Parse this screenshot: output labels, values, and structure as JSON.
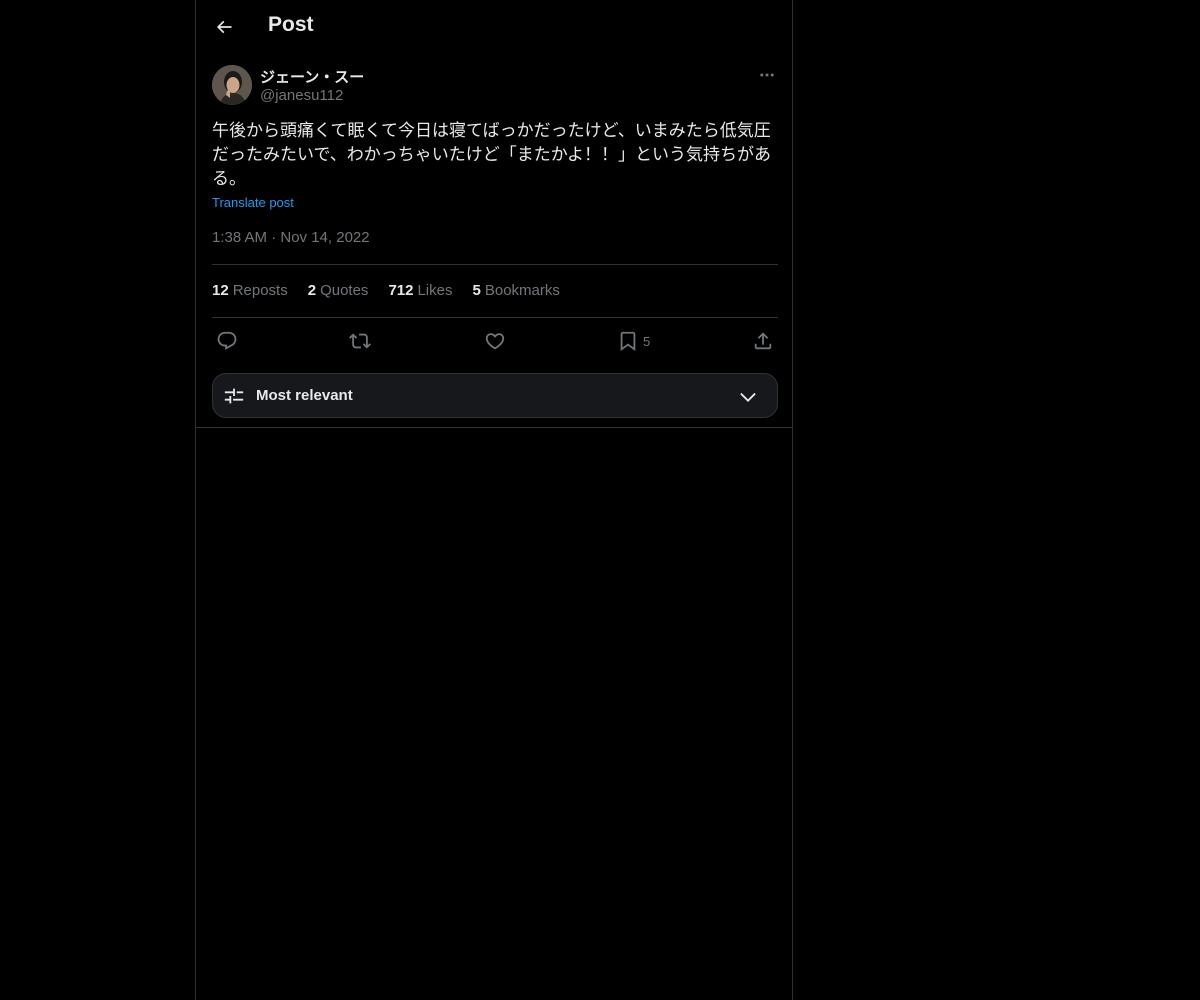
{
  "header": {
    "title": "Post"
  },
  "post": {
    "author_name": "ジェーン・スー",
    "author_handle": "@janesu112",
    "text": "午後から頭痛くて眠くて今日は寝てばっかだったけど、いまみたら低気圧だったみたいで、わかっちゃいたけど「またかよ！！」という気持ちがある。",
    "translate_label": "Translate post",
    "timestamp": "1:38 AM · Nov 14, 2022"
  },
  "stats": [
    {
      "count": "12",
      "label": "Reposts"
    },
    {
      "count": "2",
      "label": "Quotes"
    },
    {
      "count": "712",
      "label": "Likes"
    },
    {
      "count": "5",
      "label": "Bookmarks"
    }
  ],
  "actions": {
    "reply_icon": "reply-icon",
    "repost_icon": "repost-icon",
    "like_icon": "heart-icon",
    "bookmark_icon": "bookmark-icon",
    "bookmark_count": "5",
    "share_icon": "share-icon"
  },
  "sort": {
    "label": "Most relevant"
  },
  "colors": {
    "background": "#000000",
    "text_primary": "#e7e9ea",
    "text_secondary": "#71767b",
    "accent": "#1d9bf0",
    "border": "#2f3336"
  }
}
